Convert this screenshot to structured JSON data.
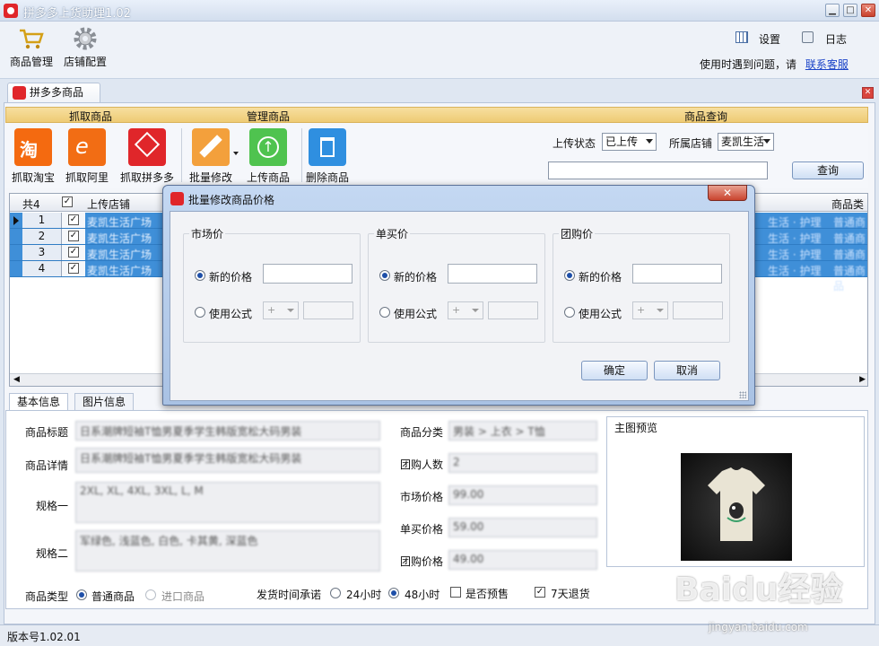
{
  "window": {
    "title": "拼多多上货助理1.02"
  },
  "topbar": {
    "product_mgmt": "商品管理",
    "shop_config": "店铺配置",
    "settings": "设置",
    "log": "日志",
    "hint": "使用时遇到问题，请",
    "contact": "联系客服"
  },
  "main_tab": {
    "label": "拼多多商品"
  },
  "groups": {
    "fetch": "抓取商品",
    "manage": "管理商品",
    "query": "商品查询"
  },
  "tools": {
    "taobao": "抓取淘宝",
    "alibaba": "抓取阿里",
    "pdd": "抓取拼多多",
    "batch_edit": "批量修改",
    "upload": "上传商品",
    "delete": "删除商品"
  },
  "query": {
    "status_label": "上传状态",
    "status_value": "已上传",
    "shop_label": "所属店铺",
    "shop_value": "麦凯生活",
    "search_button": "查询"
  },
  "grid": {
    "count_label": "共4",
    "col_shop": "上传店铺",
    "col_ca": "商品类型",
    "rows": [
      {
        "idx": "1",
        "shop": "麦凯生活广场",
        "tail1": "生活 · 护理",
        "tail2": "普通商品"
      },
      {
        "idx": "2",
        "shop": "麦凯生活广场",
        "tail1": "生活 · 护理",
        "tail2": "普通商品"
      },
      {
        "idx": "3",
        "shop": "麦凯生活广场",
        "tail1": "生活 · 护理",
        "tail2": "普通商品"
      },
      {
        "idx": "4",
        "shop": "麦凯生活广场",
        "tail1": "生活 · 护理",
        "tail2": "普通商品"
      }
    ]
  },
  "lower_tabs": {
    "basic": "基本信息",
    "images": "图片信息"
  },
  "form": {
    "title_label": "商品标题",
    "title_value": "日系潮牌短袖T恤男夏季学生韩版宽松大码男装",
    "detail_label": "商品详情",
    "detail_value": "日系潮牌短袖T恤男夏季学生韩版宽松大码男装",
    "spec1_label": "规格一",
    "spec1_value": "2XL, XL, 4XL, 3XL, L, M",
    "spec2_label": "规格二",
    "spec2_value": "军绿色, 浅蓝色, 白色, 卡其黄, 深蓝色",
    "category_label": "商品分类",
    "category_value": "男装 > 上衣 > T恤",
    "group_count_label": "团购人数",
    "group_count_value": "2",
    "market_price_label": "市场价格",
    "market_price_value": "99.00",
    "single_price_label": "单买价格",
    "single_price_value": "59.00",
    "group_price_label": "团购价格",
    "group_price_value": "49.00",
    "type_label": "商品类型",
    "type_normal": "普通商品",
    "type_import": "进口商品",
    "ship_label": "发货时间承诺",
    "ship_24": "24小时",
    "ship_48": "48小时",
    "presale": "是否预售",
    "return7": "7天退货",
    "preview_title": "主图预览"
  },
  "status": {
    "version": "版本号1.02.01"
  },
  "watermark": {
    "text": "Baidu经验",
    "url": "jingyan.baidu.com"
  },
  "dialog": {
    "title": "批量修改商品价格",
    "groups": [
      {
        "title": "市场价",
        "new_price": "新的价格",
        "formula": "使用公式",
        "op": "+"
      },
      {
        "title": "单买价",
        "new_price": "新的价格",
        "formula": "使用公式",
        "op": "+"
      },
      {
        "title": "团购价",
        "new_price": "新的价格",
        "formula": "使用公式",
        "op": "+"
      }
    ],
    "ok": "确定",
    "cancel": "取消"
  }
}
